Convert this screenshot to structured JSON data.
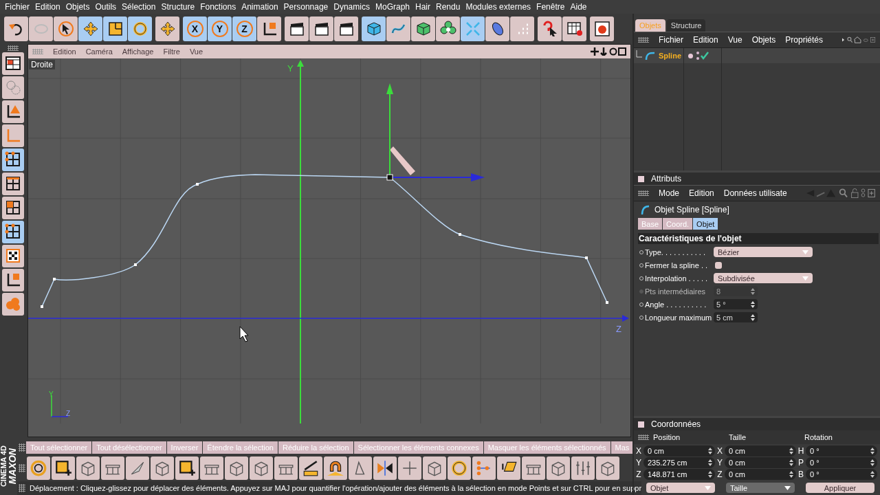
{
  "menu_bar": [
    "Fichier",
    "Edition",
    "Objets",
    "Outils",
    "Sélection",
    "Structure",
    "Fonctions",
    "Animation",
    "Personnage",
    "Dynamics",
    "MoGraph",
    "Hair",
    "Rendu",
    "Modules externes",
    "Fenêtre",
    "Aide"
  ],
  "main_toolbar": [
    {
      "buttons": [
        {
          "active": false
        },
        {
          "active": false
        },
        {
          "active": false
        },
        {
          "active": true
        },
        {
          "active": true
        },
        {
          "active": true
        }
      ]
    },
    {
      "buttons": [
        {
          "active": false
        }
      ]
    },
    {
      "buttons": [
        {
          "active": true,
          "label": "X"
        },
        {
          "active": true,
          "label": "Y"
        },
        {
          "active": true,
          "label": "Z"
        },
        {
          "active": false
        }
      ]
    },
    {
      "buttons": [
        {
          "active": false
        },
        {
          "active": false
        },
        {
          "active": false
        }
      ]
    },
    {
      "buttons": [
        {
          "active": true
        },
        {
          "active": false
        },
        {
          "active": false
        },
        {
          "active": false
        },
        {
          "active": true
        },
        {
          "active": false
        },
        {
          "active": false
        }
      ]
    },
    {
      "buttons": [
        {
          "active": false
        },
        {
          "active": false
        }
      ]
    },
    {
      "buttons": [
        {
          "active": false
        }
      ]
    }
  ],
  "mode_toolbar": [
    {
      "active": false
    },
    {
      "active": false
    },
    {
      "active": false
    },
    {
      "active": false
    },
    {
      "active": true
    },
    {
      "active": false
    },
    {
      "active": false
    },
    {
      "active": true
    },
    {
      "active": false
    },
    {
      "active": false
    },
    {
      "active": false
    }
  ],
  "viewport": {
    "menu": [
      "Edition",
      "Caméra",
      "Affichage",
      "Filtre",
      "Vue"
    ],
    "view_label": "Droite",
    "axis_labels": [
      "Y",
      "Z"
    ],
    "corner_axis_labels": [
      "Y",
      "Z"
    ]
  },
  "objects_panel": {
    "tabs": [
      {
        "label": "Objets",
        "selected": true
      },
      {
        "label": "Structure",
        "selected": false
      }
    ],
    "menu": [
      "Fichier",
      "Edition",
      "Vue",
      "Objets",
      "Propriétés"
    ],
    "objects": [
      {
        "name": "Spline",
        "enabled": true
      }
    ]
  },
  "attributes": {
    "title": "Attributs",
    "menu": [
      "Mode",
      "Edition",
      "Données utilisate"
    ],
    "object_title": "Objet Spline [Spline]",
    "tabs": [
      {
        "label": "Base",
        "selected": false
      },
      {
        "label": "Coord.",
        "selected": false
      },
      {
        "label": "Objet",
        "selected": true
      }
    ],
    "section": "Caractéristiques de l'objet",
    "fields": [
      {
        "kind": "dropdown",
        "label": "Type. . . . . . . . . . .",
        "value": "Bézier",
        "animatable": true
      },
      {
        "kind": "checkbox",
        "label": "Fermer la spline  . .",
        "checked": false,
        "animatable": true
      },
      {
        "kind": "dropdown",
        "label": "Interpolation . . . . .",
        "value": "Subdivisée",
        "animatable": true
      },
      {
        "kind": "number",
        "label": "Pts intermédiaires",
        "value": "8",
        "disabled": true,
        "animatable": false
      },
      {
        "kind": "number",
        "label": "Angle . . . . . . . . . .",
        "value": "5 °",
        "disabled": false,
        "animatable": true
      },
      {
        "kind": "number",
        "label": "Longueur maximum",
        "value": "5 cm",
        "disabled": false,
        "animatable": true
      }
    ]
  },
  "coordinates": {
    "title": "Coordonnées",
    "headers": [
      "Position",
      "Taille",
      "Rotation"
    ],
    "rows": [
      [
        {
          "axis": "X",
          "value": "0 cm"
        },
        {
          "axis": "X",
          "value": "0 cm"
        },
        {
          "axis": "H",
          "value": "0 °"
        }
      ],
      [
        {
          "axis": "Y",
          "value": "235.275 cm"
        },
        {
          "axis": "Y",
          "value": "0 cm"
        },
        {
          "axis": "P",
          "value": "0 °"
        }
      ],
      [
        {
          "axis": "Z",
          "value": "148.871 cm"
        },
        {
          "axis": "Z",
          "value": "0 cm"
        },
        {
          "axis": "B",
          "value": "0 °"
        }
      ]
    ],
    "buttons": [
      {
        "kind": "dropdown",
        "label": "Objet"
      },
      {
        "kind": "dropdown",
        "label": "Taille"
      },
      {
        "kind": "button",
        "label": "Appliquer"
      }
    ]
  },
  "selection_toolbar": [
    "Tout sélectionner",
    "Tout désélectionner",
    "Inverser",
    "Étendre la sélection",
    "Réduire la sélection",
    "Sélectionner les éléments connexes",
    "Masquer les éléments sélectionnés",
    "Mas"
  ],
  "logo": [
    "MAXON",
    "CINEMA 4D"
  ],
  "status_bar": "Déplacement : Cliquez-glissez pour déplacer des éléments. Appuyez sur MAJ pour quantifier l'opération/ajouter des éléments à la sélection en mode Points et sur CTRL pour en suppr"
}
